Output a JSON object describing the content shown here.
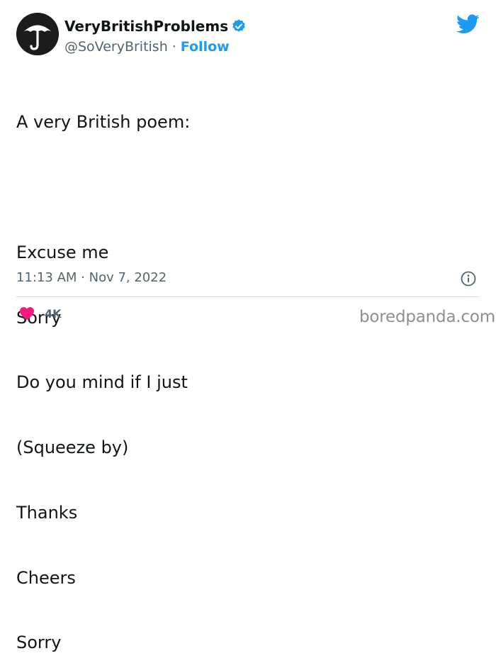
{
  "account": {
    "display_name": "VeryBritishProblems",
    "handle": "@SoVeryBritish",
    "separator": "·",
    "follow_label": "Follow"
  },
  "tweet": {
    "lines": [
      "A very British poem:",
      "",
      "Excuse me",
      "Sorry",
      "Do you mind if I just",
      "(Squeeze by)",
      "Thanks",
      "Cheers",
      "Sorry"
    ],
    "timestamp": "11:13 AM · Nov 7, 2022"
  },
  "engagement": {
    "likes": "4K"
  },
  "icons": {
    "avatar": "umbrella-logo",
    "verified": "verified-badge-icon",
    "platform": "twitter-bird-icon",
    "info": "info-icon",
    "like": "heart-icon"
  },
  "colors": {
    "accent": "#1d9bf0",
    "heart": "#f91880",
    "muted": "#536471",
    "text": "#0f1419"
  },
  "watermark": "boredpanda.com"
}
